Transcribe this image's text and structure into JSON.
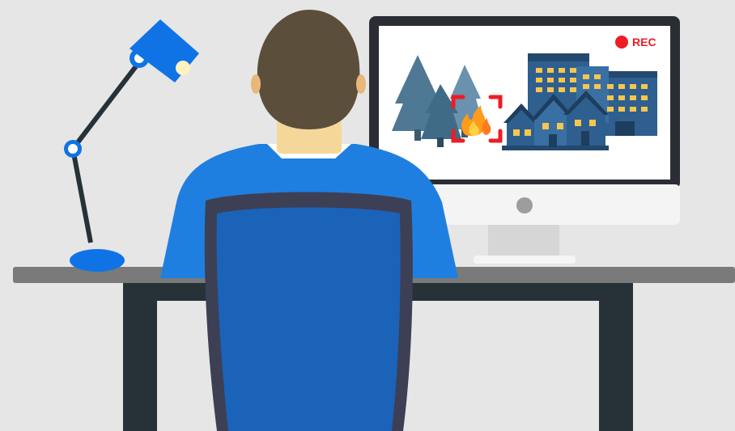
{
  "monitor": {
    "rec_indicator": {
      "label": "REC",
      "dot_color": "#ee1c25"
    }
  },
  "palette": {
    "background": "#e6e6e6",
    "desk_top": "#7a7a7a",
    "desk_legs": "#263238",
    "lamp_blue": "#0f73e6",
    "shirt_blue": "#1f7fe0",
    "chair_back": "#3d3f55",
    "hair": "#5b4e3b",
    "neck": "#f6d79a",
    "monitor_frame": "#2b2d35",
    "monitor_stand": "#dadada",
    "fire": "#ff9c1a",
    "detection_box": "#ee1c25",
    "trees": "#4f7895",
    "buildings": "#2f5f8f",
    "windows": "#f7c64c"
  },
  "icons": [
    "desk-lamp-icon",
    "person-icon",
    "office-chair-icon",
    "computer-monitor-icon",
    "fire-icon",
    "detection-frame-icon",
    "pine-tree-icon",
    "apartment-building-icon",
    "house-icon",
    "record-dot-icon"
  ]
}
